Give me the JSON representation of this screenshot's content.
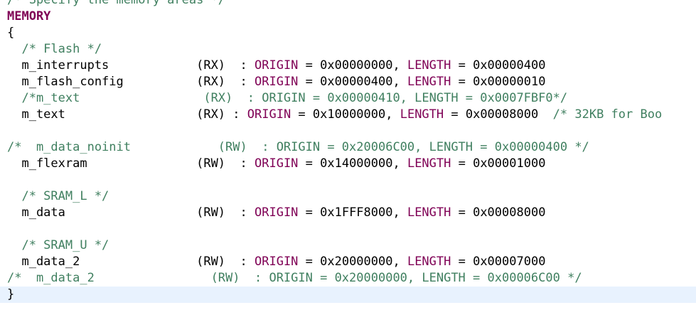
{
  "editor": {
    "colors": {
      "comment": "#3f7f5f",
      "keyword": "#7f0055",
      "plain": "#000000",
      "current_line": "#e8f2fe"
    },
    "lines": [
      {
        "segments": [
          {
            "text": "/* Specify the memory areas */",
            "kind": "comment"
          }
        ]
      },
      {
        "segments": [
          {
            "text": "MEMORY",
            "kind": "keyword"
          }
        ]
      },
      {
        "segments": [
          {
            "text": "{",
            "kind": "plain"
          }
        ]
      },
      {
        "segments": [
          {
            "text": "  /* Flash */",
            "kind": "comment"
          }
        ]
      },
      {
        "segments": [
          {
            "text": "  m_interrupts            (RX)  : ",
            "kind": "plain"
          },
          {
            "text": "ORIGIN",
            "kind": "field"
          },
          {
            "text": " = 0x00000000, ",
            "kind": "plain"
          },
          {
            "text": "LENGTH",
            "kind": "field"
          },
          {
            "text": " = 0x00000400",
            "kind": "plain"
          }
        ]
      },
      {
        "segments": [
          {
            "text": "  m_flash_config          (RX)  : ",
            "kind": "plain"
          },
          {
            "text": "ORIGIN",
            "kind": "field"
          },
          {
            "text": " = 0x00000400, ",
            "kind": "plain"
          },
          {
            "text": "LENGTH",
            "kind": "field"
          },
          {
            "text": " = 0x00000010",
            "kind": "plain"
          }
        ]
      },
      {
        "segments": [
          {
            "text": "  /*m_text                 (RX)  : ORIGIN = 0x00000410, LENGTH = 0x0007FBF0*/",
            "kind": "comment"
          }
        ]
      },
      {
        "segments": [
          {
            "text": "  m_text                  (RX) : ",
            "kind": "plain"
          },
          {
            "text": "ORIGIN",
            "kind": "field"
          },
          {
            "text": " = 0x10000000, ",
            "kind": "plain"
          },
          {
            "text": "LENGTH",
            "kind": "field"
          },
          {
            "text": " = 0x00008000  ",
            "kind": "plain"
          },
          {
            "text": "/* 32KB for Boo",
            "kind": "comment"
          }
        ]
      },
      {
        "segments": []
      },
      {
        "segments": [
          {
            "text": "/*  m_data_noinit            (RW)  : ORIGIN = 0x20006C00, LENGTH = 0x00000400 */",
            "kind": "comment"
          }
        ]
      },
      {
        "segments": [
          {
            "text": "  m_flexram               (RW)  : ",
            "kind": "plain"
          },
          {
            "text": "ORIGIN",
            "kind": "field"
          },
          {
            "text": " = 0x14000000, ",
            "kind": "plain"
          },
          {
            "text": "LENGTH",
            "kind": "field"
          },
          {
            "text": " = 0x00001000",
            "kind": "plain"
          }
        ]
      },
      {
        "segments": []
      },
      {
        "segments": [
          {
            "text": "  /* SRAM_L */",
            "kind": "comment"
          }
        ]
      },
      {
        "segments": [
          {
            "text": "  m_data                  (RW)  : ",
            "kind": "plain"
          },
          {
            "text": "ORIGIN",
            "kind": "field"
          },
          {
            "text": " = 0x1FFF8000, ",
            "kind": "plain"
          },
          {
            "text": "LENGTH",
            "kind": "field"
          },
          {
            "text": " = 0x00008000",
            "kind": "plain"
          }
        ]
      },
      {
        "segments": []
      },
      {
        "segments": [
          {
            "text": "  /* SRAM_U */",
            "kind": "comment"
          }
        ]
      },
      {
        "segments": [
          {
            "text": "  m_data_2                (RW)  : ",
            "kind": "plain"
          },
          {
            "text": "ORIGIN",
            "kind": "field"
          },
          {
            "text": " = 0x20000000, ",
            "kind": "plain"
          },
          {
            "text": "LENGTH",
            "kind": "field"
          },
          {
            "text": " = 0x00007000",
            "kind": "plain"
          }
        ]
      },
      {
        "segments": [
          {
            "text": "/*  m_data_2                (RW)  : ORIGIN = 0x20000000, LENGTH = 0x00006C00 */",
            "kind": "comment"
          }
        ]
      },
      {
        "segments": [
          {
            "text": "}",
            "kind": "plain"
          }
        ],
        "current": true
      }
    ]
  }
}
